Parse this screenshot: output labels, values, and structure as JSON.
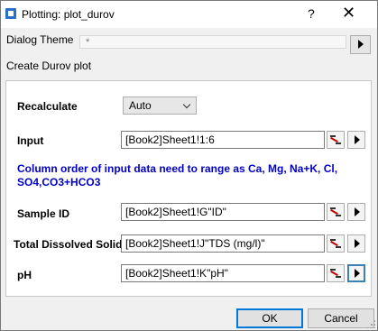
{
  "window": {
    "title": "Plotting: plot_durov",
    "help": "?",
    "close": "✕"
  },
  "theme": {
    "label": "Dialog Theme",
    "value": "*"
  },
  "description": "Create Durov plot",
  "form": {
    "recalculate": {
      "label": "Recalculate",
      "value": "Auto"
    },
    "input": {
      "label": "Input",
      "value": "[Book2]Sheet1!1:6"
    },
    "note": "Column order of input data need to range as Ca, Mg, Na+K, Cl, SO4,CO3+HCO3",
    "sample_id": {
      "label": "Sample ID",
      "value": "[Book2]Sheet1!G\"ID\""
    },
    "tds": {
      "label": "Total Dissolved Solids",
      "value": "[Book2]Sheet1!J\"TDS (mg/l)\""
    },
    "ph": {
      "label": "pH",
      "value": "[Book2]Sheet1!K\"pH\""
    }
  },
  "buttons": {
    "ok": "OK",
    "cancel": "Cancel"
  },
  "colors": {
    "note_text": "#0000c8",
    "focus_border": "#0078d7"
  },
  "icons": {
    "app": "app-icon",
    "arrow": "triangle-right-icon",
    "picker": "range-select-icon"
  }
}
